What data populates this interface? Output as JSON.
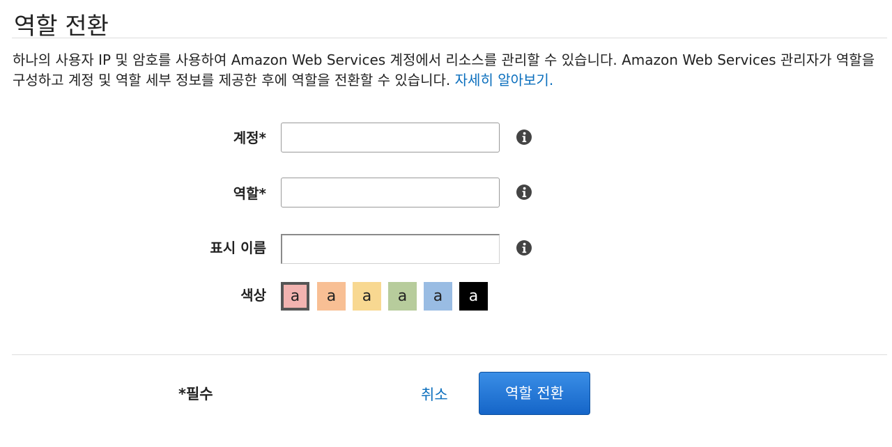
{
  "page": {
    "title": "역할 전환",
    "description": "하나의 사용자 IP 및 암호를 사용하여 Amazon Web Services 계정에서 리소스를 관리할 수 있습니다. Amazon Web Services 관리자가 역할을 구성하고 계정 및 역할 세부 정보를 제공한 후에 역할을 전환할 수 있습니다. ",
    "learn_more": "자세히 알아보기."
  },
  "form": {
    "account": {
      "label": "계정*",
      "value": ""
    },
    "role": {
      "label": "역할*",
      "value": ""
    },
    "display_name": {
      "label": "표시 이름",
      "value": ""
    },
    "color": {
      "label": "색상",
      "swatches": [
        {
          "text": "a",
          "color": "#f2b3b0",
          "text_color": "#222222",
          "selected": true
        },
        {
          "text": "a",
          "color": "#f8bf94",
          "text_color": "#222222",
          "selected": false
        },
        {
          "text": "a",
          "color": "#f8d891",
          "text_color": "#222222",
          "selected": false
        },
        {
          "text": "a",
          "color": "#b7cc9c",
          "text_color": "#222222",
          "selected": false
        },
        {
          "text": "a",
          "color": "#99bce3",
          "text_color": "#222222",
          "selected": false
        },
        {
          "text": "a",
          "color": "#000000",
          "text_color": "#ffffff",
          "selected": false
        }
      ]
    }
  },
  "footer": {
    "required_note": "*필수",
    "cancel_label": "취소",
    "submit_label": "역할 전환"
  },
  "icons": {
    "info": "info-circle-icon"
  },
  "colors": {
    "link": "#0a6ebd",
    "button_top": "#3a8ee6",
    "button_bottom": "#1565c8"
  }
}
